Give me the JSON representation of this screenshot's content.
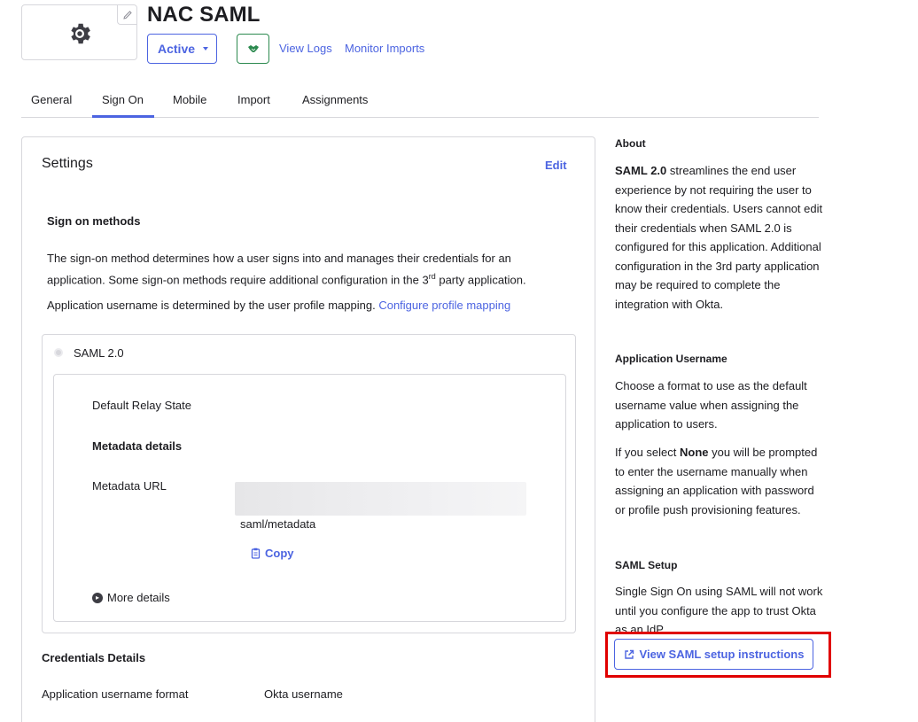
{
  "header": {
    "app_title": "NAC SAML",
    "status_label": "Active",
    "view_logs": "View Logs",
    "monitor_imports": "Monitor Imports"
  },
  "tabs": [
    {
      "label": "General"
    },
    {
      "label": "Sign On",
      "active": true
    },
    {
      "label": "Mobile"
    },
    {
      "label": "Import"
    },
    {
      "label": "Assignments"
    }
  ],
  "settings": {
    "title": "Settings",
    "edit": "Edit",
    "sign_on_methods_title": "Sign on methods",
    "para1_a": "The sign-on method determines how a user signs into and manages their credentials for an application. Some sign-on methods require additional configuration in the 3",
    "para1_sup": "rd",
    "para1_b": " party application.",
    "para2_text": "Application username is determined by the user profile mapping. ",
    "para2_link": "Configure profile mapping",
    "saml_option": "SAML 2.0",
    "default_relay_state": "Default Relay State",
    "metadata_details": "Metadata details",
    "metadata_url_label": "Metadata URL",
    "metadata_url_suffix": "saml/metadata",
    "copy_label": "Copy",
    "more_details": "More details",
    "credentials_title": "Credentials Details",
    "cred_username_format_label": "Application username format",
    "cred_username_format_value": "Okta username"
  },
  "sidebar": {
    "about_title": "About",
    "about_bold": "SAML 2.0",
    "about_text": " streamlines the end user experience by not requiring the user to know their credentials. Users cannot edit their credentials when SAML 2.0 is configured for this application. Additional configuration in the 3rd party application may be required to complete the integration with Okta.",
    "app_username_title": "Application Username",
    "app_username_text": "Choose a format to use as the default username value when assigning the application to users.",
    "none_pre": "If you select ",
    "none_bold": "None",
    "none_post": " you will be prompted to enter the username manually when assigning an application with password or profile push provisioning features.",
    "saml_setup_title": "SAML Setup",
    "saml_setup_text": "Single Sign On using SAML will not work until you configure the app to trust Okta as an IdP.",
    "view_instructions": "View SAML setup instructions"
  },
  "colors": {
    "accent": "#4c64e1",
    "success": "#2c8a4f",
    "highlight": "#e00000"
  }
}
